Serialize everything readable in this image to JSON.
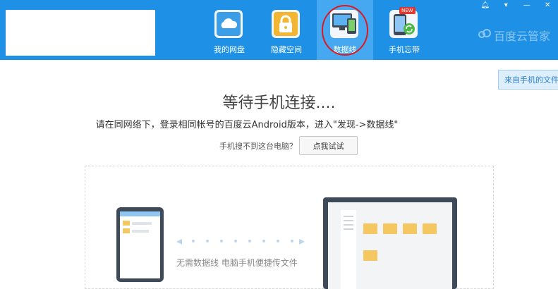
{
  "window": {
    "controls": [
      "bell-icon",
      "menu-icon",
      "minimize-icon",
      "close-icon"
    ]
  },
  "nav": {
    "items": [
      {
        "label": "我的网盘",
        "icon": "cloud-icon"
      },
      {
        "label": "隐藏空间",
        "icon": "lock-icon"
      },
      {
        "label": "数据线",
        "icon": "devices-icon",
        "active": true
      },
      {
        "label": "手机忘带",
        "icon": "phone-sync-icon",
        "badge": "NEW"
      }
    ]
  },
  "brand": {
    "name": "百度云管家"
  },
  "side_button": {
    "label": "来自手机的文件"
  },
  "main": {
    "title": "等待手机连接....",
    "instruction": "请在同网络下，登录相同帐号的百度云Android版本，进入\"发现->数据线\"",
    "hint": "手机搜不到这台电脑？",
    "try_button": "点我试试",
    "caption": "无需数据线 电脑手机便捷传文件"
  },
  "colors": {
    "topbar": "#1e91e6",
    "active_tab": "#45a8f0",
    "folder": "#f5c760",
    "device": "#3e4a57",
    "annotation_circle": "#e0181b"
  }
}
